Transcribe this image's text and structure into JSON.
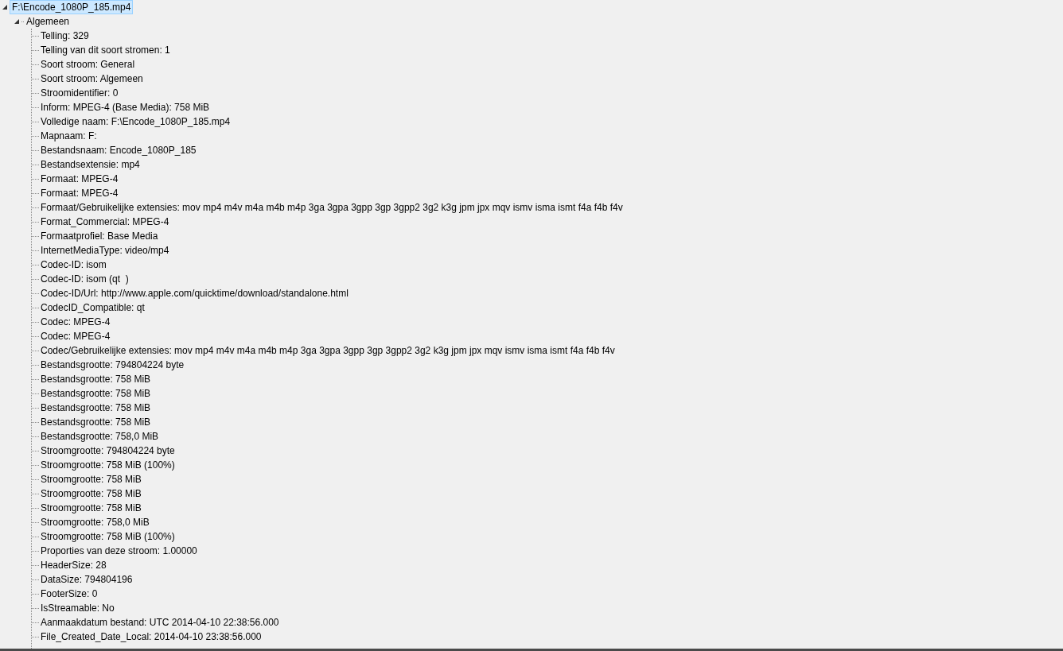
{
  "tree": {
    "label": "F:\\Encode_1080P_185.mp4",
    "selected": true,
    "expanded": true,
    "children": [
      {
        "label": "Algemeen",
        "selected": false,
        "expanded": true,
        "children": [
          {
            "label": "Telling: 329",
            "selected": false
          },
          {
            "label": "Telling van dit soort stromen: 1",
            "selected": false
          },
          {
            "label": "Soort stroom: General",
            "selected": false
          },
          {
            "label": "Soort stroom: Algemeen",
            "selected": false
          },
          {
            "label": "Stroomidentifier: 0",
            "selected": false
          },
          {
            "label": "Inform: MPEG-4 (Base Media): 758 MiB",
            "selected": false
          },
          {
            "label": "Volledige naam: F:\\Encode_1080P_185.mp4",
            "selected": false
          },
          {
            "label": "Mapnaam: F:",
            "selected": false
          },
          {
            "label": "Bestandsnaam: Encode_1080P_185",
            "selected": false
          },
          {
            "label": "Bestandsextensie: mp4",
            "selected": false
          },
          {
            "label": "Formaat: MPEG-4",
            "selected": false
          },
          {
            "label": "Formaat: MPEG-4",
            "selected": false
          },
          {
            "label": "Formaat/Gebruikelijke extensies: mov mp4 m4v m4a m4b m4p 3ga 3gpa 3gpp 3gp 3gpp2 3g2 k3g jpm jpx mqv ismv isma ismt f4a f4b f4v",
            "selected": false
          },
          {
            "label": "Format_Commercial: MPEG-4",
            "selected": false
          },
          {
            "label": "Formaatprofiel: Base Media",
            "selected": false
          },
          {
            "label": "InternetMediaType: video/mp4",
            "selected": false
          },
          {
            "label": "Codec-ID: isom",
            "selected": false
          },
          {
            "label": "Codec-ID: isom (qt  )",
            "selected": false
          },
          {
            "label": "Codec-ID/Url: http://www.apple.com/quicktime/download/standalone.html",
            "selected": false
          },
          {
            "label": "CodecID_Compatible: qt",
            "selected": false
          },
          {
            "label": "Codec: MPEG-4",
            "selected": false
          },
          {
            "label": "Codec: MPEG-4",
            "selected": false
          },
          {
            "label": "Codec/Gebruikelijke extensies: mov mp4 m4v m4a m4b m4p 3ga 3gpa 3gpp 3gp 3gpp2 3g2 k3g jpm jpx mqv ismv isma ismt f4a f4b f4v",
            "selected": false
          },
          {
            "label": "Bestandsgrootte: 794804224 byte",
            "selected": false
          },
          {
            "label": "Bestandsgrootte: 758 MiB",
            "selected": false
          },
          {
            "label": "Bestandsgrootte: 758 MiB",
            "selected": false
          },
          {
            "label": "Bestandsgrootte: 758 MiB",
            "selected": false
          },
          {
            "label": "Bestandsgrootte: 758 MiB",
            "selected": false
          },
          {
            "label": "Bestandsgrootte: 758,0 MiB",
            "selected": false
          },
          {
            "label": "Stroomgrootte: 794804224 byte",
            "selected": false
          },
          {
            "label": "Stroomgrootte: 758 MiB (100%)",
            "selected": false
          },
          {
            "label": "Stroomgrootte: 758 MiB",
            "selected": false
          },
          {
            "label": "Stroomgrootte: 758 MiB",
            "selected": false
          },
          {
            "label": "Stroomgrootte: 758 MiB",
            "selected": false
          },
          {
            "label": "Stroomgrootte: 758,0 MiB",
            "selected": false
          },
          {
            "label": "Stroomgrootte: 758 MiB (100%)",
            "selected": false
          },
          {
            "label": "Proporties van deze stroom: 1.00000",
            "selected": false
          },
          {
            "label": "HeaderSize: 28",
            "selected": false
          },
          {
            "label": "DataSize: 794804196",
            "selected": false
          },
          {
            "label": "FooterSize: 0",
            "selected": false
          },
          {
            "label": "IsStreamable: No",
            "selected": false
          },
          {
            "label": "Aanmaakdatum bestand: UTC 2014-04-10 22:38:56.000",
            "selected": false
          },
          {
            "label": "File_Created_Date_Local: 2014-04-10 23:38:56.000",
            "selected": false
          }
        ]
      }
    ]
  }
}
